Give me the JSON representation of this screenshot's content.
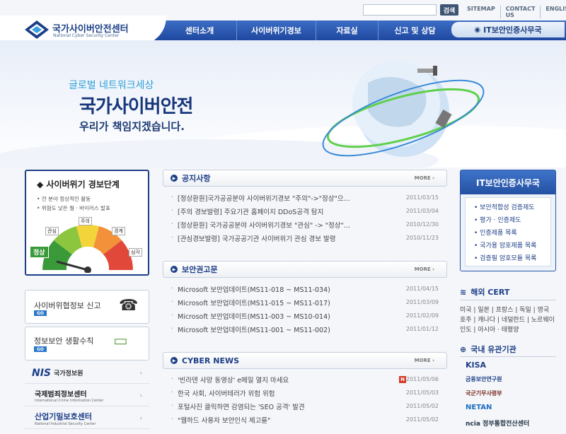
{
  "utility": {
    "search_placeholder": "",
    "search_button": "검색",
    "links": [
      "SITEMAP",
      "CONTACT US",
      "ENGLISH"
    ]
  },
  "logo": {
    "kr": "국가사이버안전센터",
    "en": "National Cyber Security Center"
  },
  "gnb": {
    "items": [
      "센터소개",
      "사이버위기경보",
      "자료실",
      "신고 및 상담"
    ],
    "cert": "IT보안인증사무국"
  },
  "visual": {
    "sub": "글로벌 네트워크세상",
    "title": "국가사이버안전",
    "desc": "우리가 책임지겠습니다."
  },
  "alert": {
    "title": "사이버위기 경보단계",
    "lines": [
      "전 분야 정상적인 활동",
      "위험도 낮은 웜 · 바이러스 발표"
    ],
    "levels": [
      "정상",
      "관심",
      "주의",
      "경계",
      "심각"
    ],
    "current_level": "정상",
    "colors": {
      "normal": "#3a9a3a",
      "interest": "#8cc63e",
      "caution": "#f3d43a",
      "alert": "#f2913a",
      "serious": "#e1483a"
    }
  },
  "banners": [
    {
      "label": "사이버위협정보 신고",
      "go": "GO"
    },
    {
      "label": "정보보안 생활수칙",
      "go": "GO"
    }
  ],
  "orgs": [
    {
      "name": "NIS",
      "sub": "국가정보원"
    },
    {
      "name": "국제범죄정보센터",
      "sub": "International Crime Information Center"
    },
    {
      "name": "산업기밀보호센터",
      "sub": "National Industrial Security Center"
    }
  ],
  "notice": {
    "title": "공지사항",
    "more": "MORE",
    "items": [
      {
        "title": "[정상환원]국가공공분야 사이버위기경보 \"주의\"->\"정상\"으...",
        "date": "2011/03/15"
      },
      {
        "title": "[주의 경보발령] 주요기관 홈페이지 DDoS공격 탐지",
        "date": "2011/03/04"
      },
      {
        "title": "[정상환원] 국가공공분야 사이버위기경보 \"관심\" -> \"정상\"...",
        "date": "2010/12/30"
      },
      {
        "title": "[관심경보발령] 국가공공기관 사이버위기 관심 경보 발령",
        "date": "2010/11/23"
      }
    ]
  },
  "advisory": {
    "title": "보안권고문",
    "more": "MORE",
    "items": [
      {
        "title": "Microsoft 보안업데이트(MS11-018 ~ MS11-034)",
        "date": "2011/04/15"
      },
      {
        "title": "Microsoft 보안업데이트(MS11-015 ~ MS11-017)",
        "date": "2011/03/09"
      },
      {
        "title": "Microsoft 보안업데이트(MS11-003 ~ MS10-014)",
        "date": "2011/02/09"
      },
      {
        "title": "Microsoft 보안업데이트(MS11-001 ~ MS11-002)",
        "date": "2011/01/12"
      }
    ]
  },
  "cyber": {
    "title": "CYBER NEWS",
    "more": "MORE",
    "new_badge": "N",
    "items": [
      {
        "title": "'빈라덴 사망 동영상' e메일 열지 마세요",
        "date": "2011/05/06"
      },
      {
        "title": "한국 사회, 사이버테러가 위험 위험",
        "date": "2011/05/03"
      },
      {
        "title": "포털사진 클릭하면 감염되는 'SEO 공격' 발견",
        "date": "2011/05/02"
      },
      {
        "title": "\"웹하드 사용자 보안인식 제고를\"",
        "date": "2011/05/02"
      }
    ]
  },
  "itcert": {
    "title": "IT보안인증사무국",
    "items": [
      "보안적합성 검증제도",
      "평가 · 인증제도",
      "인증제품 목록",
      "국가용 암호제품 목록",
      "검증필 암호모듈 목록"
    ]
  },
  "overseas": {
    "title": "해외 CERT",
    "lines": [
      "미국 | 일본 | 프랑스 | 독일 | 영국",
      "호주 | 캐나다 | 네덜란드 | 노르웨이",
      "인도 | 아시아 · 태평양"
    ]
  },
  "domestic": {
    "title": "국내 유관기관",
    "partners": [
      "KISA",
      "금융보안연구원",
      "국군기무사령부",
      "NETAN",
      "ncia 정부통합전산센터"
    ]
  }
}
